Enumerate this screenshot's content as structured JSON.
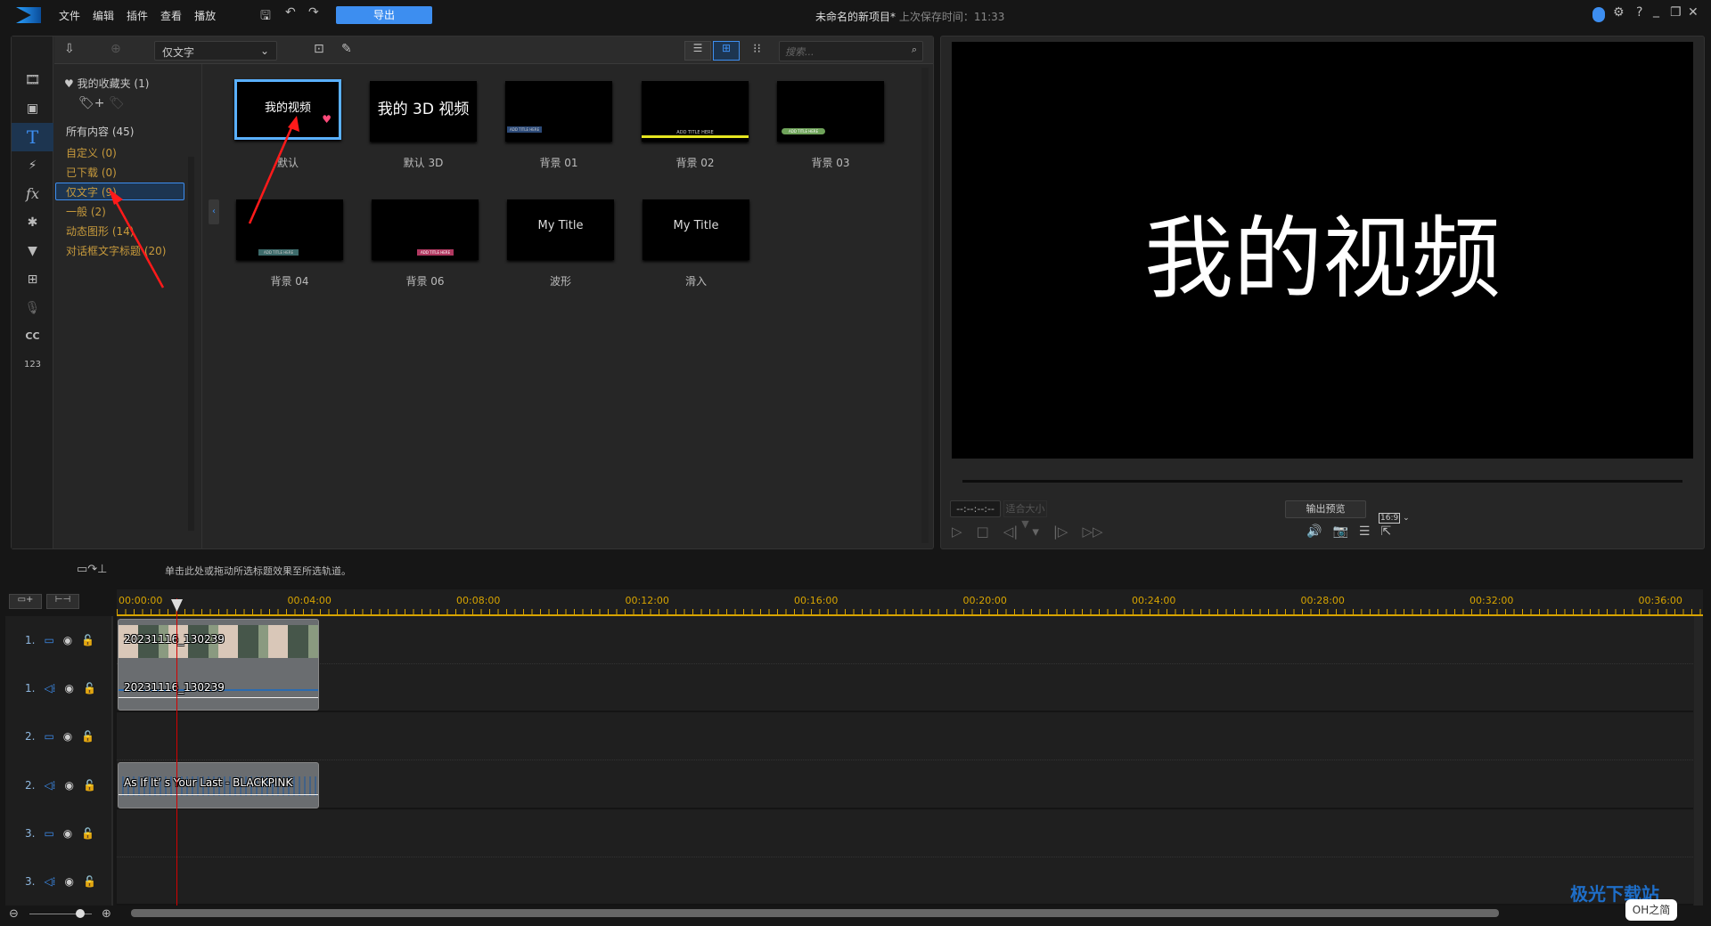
{
  "titlebar": {
    "menu": [
      "文件",
      "编辑",
      "插件",
      "查看",
      "播放"
    ],
    "export": "导出",
    "project": "未命名的新项目*",
    "saved": "上次保存时间：11:33"
  },
  "library": {
    "filter": "仅文字",
    "search_placeholder": "搜索...",
    "favorites": "我的收藏夹 (1)",
    "all": "所有内容 (45)",
    "categories": [
      "自定义 (0)",
      "已下载 (0)",
      "仅文字 (9)",
      "一般 (2)",
      "动态图形 (14)",
      "对话框文字标题 (20)"
    ],
    "selected_category": "仅文字 (9)",
    "thumbs": [
      {
        "label": "默认",
        "text": "我的视频"
      },
      {
        "label": "默认 3D",
        "text": "我的 3D 视频"
      },
      {
        "label": "背景 01",
        "text": "ADD TITLE HERE"
      },
      {
        "label": "背景 02",
        "text": "ADD TITLE HERE"
      },
      {
        "label": "背景 03",
        "text": "ADD TITLE HERE"
      },
      {
        "label": "背景 04",
        "text": "ADD TITLE HERE"
      },
      {
        "label": "背景 06",
        "text": "ADD TITLE HERE"
      },
      {
        "label": "波形",
        "text": "My Title"
      },
      {
        "label": "滑入",
        "text": "My Title"
      }
    ]
  },
  "preview": {
    "text": "我的视频",
    "timecode": "--:--:--:--",
    "fit": "适合大小 ▼",
    "output_preview": "输出预览",
    "aspect": "16:9"
  },
  "timeline": {
    "hint": "单击此处或拖动所选标题效果至所选轨道。",
    "ticks": [
      "00:00:00",
      "00:04:00",
      "00:08:00",
      "00:12:00",
      "00:16:00",
      "00:20:00",
      "00:24:00",
      "00:28:00",
      "00:32:00",
      "00:36:00"
    ],
    "tracks": [
      "1.",
      "1.",
      "2.",
      "2.",
      "3.",
      "3."
    ],
    "clips": {
      "video": "20231116_130239",
      "audio": "20231116_130239",
      "music": "As If It’  s Your Last - BLACKPINK"
    }
  },
  "watermark": {
    "text": "极光下载站",
    "sub": "OH之简"
  },
  "colors": {
    "accent": "#3d8ef0",
    "category": "#c79a3c",
    "ruler": "#d7a400",
    "playhead": "#d40000"
  }
}
